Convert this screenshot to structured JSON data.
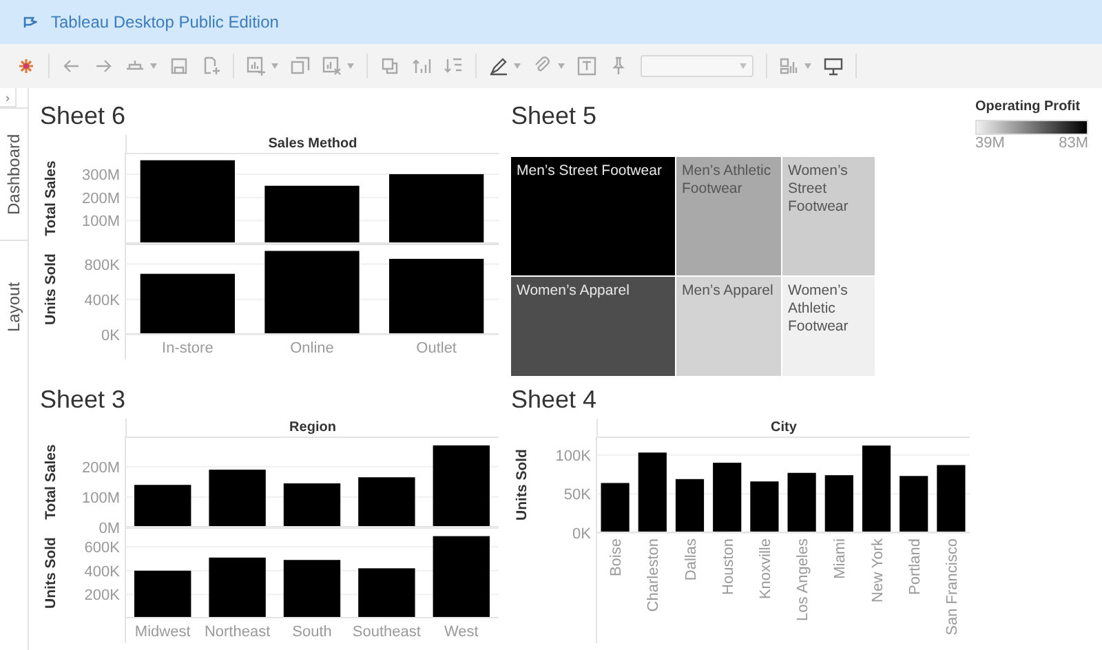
{
  "window": {
    "title": "Tableau Desktop Public Edition"
  },
  "side_panel": {
    "toggle": "›",
    "tabs": [
      {
        "label": "Dashboard"
      },
      {
        "label": "Layout"
      }
    ]
  },
  "sheets": [
    {
      "kind": "bar",
      "title": "Sheet 6",
      "column_header": "Sales Method",
      "categories": [
        "In-store",
        "Online",
        "Outlet"
      ],
      "panels": [
        {
          "chart_data": {
            "type": "bar",
            "ylabel": "Total Sales",
            "grid": true,
            "values": [
              360000000,
              250000000,
              300000000
            ],
            "ylim": [
              0,
              380000000
            ],
            "yticks": [
              {
                "value": 100000000,
                "label": "100M"
              },
              {
                "value": 200000000,
                "label": "200M"
              },
              {
                "value": 300000000,
                "label": "300M"
              }
            ]
          }
        },
        {
          "chart_data": {
            "type": "bar",
            "ylabel": "Units Sold",
            "grid": true,
            "values": [
              690000,
              950000,
              860000
            ],
            "ylim": [
              0,
              1000000
            ],
            "yticks": [
              {
                "value": 0,
                "label": "0K"
              },
              {
                "value": 400000,
                "label": "400K"
              },
              {
                "value": 800000,
                "label": "800K"
              }
            ]
          }
        }
      ]
    },
    {
      "kind": "treemap",
      "title": "Sheet 5",
      "tiles": [
        {
          "label": "Men’s Street Footwear",
          "color": "#000000"
        },
        {
          "label": "Men’s Athletic Footwear",
          "color": "#a9a9a9"
        },
        {
          "label": "Women’s Street Footwear",
          "color": "#cdcdcd"
        },
        {
          "label": "Women’s Apparel",
          "color": "#4d4d4d"
        },
        {
          "label": "Men’s Apparel",
          "color": "#d3d3d3"
        },
        {
          "label": "Women’s Athletic Footwear",
          "color": "#f0f0f0"
        }
      ],
      "legend": {
        "title": "Operating Profit",
        "min_label": "39M",
        "max_label": "83M"
      }
    },
    {
      "kind": "bar",
      "title": "Sheet 3",
      "column_header": "Region",
      "categories": [
        "Midwest",
        "Northeast",
        "South",
        "Southeast",
        "West"
      ],
      "panels": [
        {
          "chart_data": {
            "type": "bar",
            "ylabel": "Total Sales",
            "grid": true,
            "values": [
              140000000,
              190000000,
              145000000,
              165000000,
              270000000
            ],
            "ylim": [
              0,
              290000000
            ],
            "yticks": [
              {
                "value": 0,
                "label": "0M"
              },
              {
                "value": 100000000,
                "label": "100M"
              },
              {
                "value": 200000000,
                "label": "200M"
              }
            ]
          }
        },
        {
          "chart_data": {
            "type": "bar",
            "ylabel": "Units Sold",
            "grid": true,
            "values": [
              400000,
              510000,
              490000,
              420000,
              690000
            ],
            "ylim": [
              0,
              740000
            ],
            "yticks": [
              {
                "value": 200000,
                "label": "200K"
              },
              {
                "value": 400000,
                "label": "400K"
              },
              {
                "value": 600000,
                "label": "600K"
              }
            ]
          }
        }
      ]
    },
    {
      "kind": "bar",
      "title": "Sheet 4",
      "column_header": "City",
      "categories": [
        "Boise",
        "Charleston",
        "Dallas",
        "Houston",
        "Knoxville",
        "Los Angeles",
        "Miami",
        "New York",
        "Portland",
        "San Francisco"
      ],
      "panels": [
        {
          "chart_data": {
            "type": "bar",
            "ylabel": "Units Sold",
            "grid": true,
            "values": [
              64000,
              103000,
              69000,
              90000,
              66000,
              77000,
              74000,
              112000,
              73000,
              87000
            ],
            "ylim": [
              0,
              120000
            ],
            "yticks": [
              {
                "value": 0,
                "label": "0K"
              },
              {
                "value": 50000,
                "label": "50K"
              },
              {
                "value": 100000,
                "label": "100K"
              }
            ]
          }
        }
      ]
    }
  ]
}
